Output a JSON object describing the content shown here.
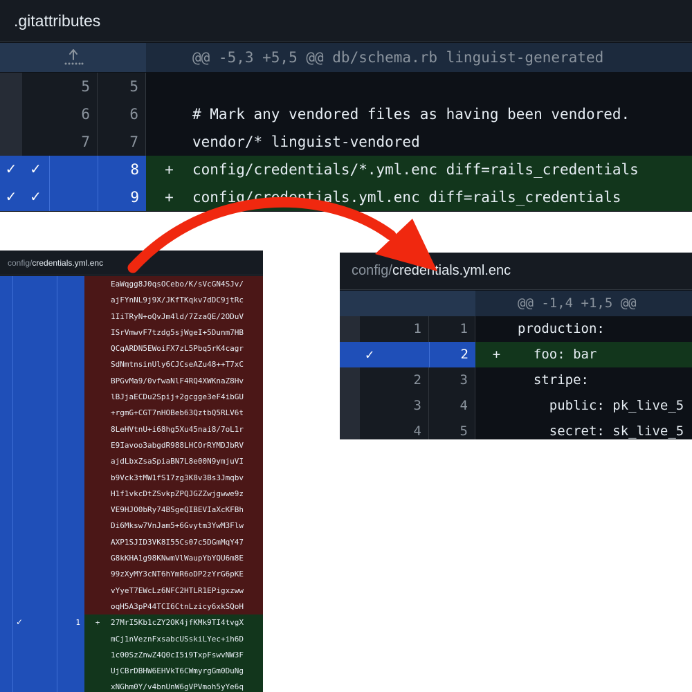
{
  "gitattributes_panel": {
    "filename": ".gitattributes",
    "expand_icon": "expand-up-icon",
    "hunk_header": "@@ -5,3 +5,5 @@ db/schema.rb linguist-generated",
    "lines": [
      {
        "old": "5",
        "new": "5",
        "sign": "",
        "code": "",
        "type": "context",
        "checked": false
      },
      {
        "old": "6",
        "new": "6",
        "sign": "",
        "code": "# Mark any vendored files as having been vendored.",
        "type": "context",
        "checked": false
      },
      {
        "old": "7",
        "new": "7",
        "sign": "",
        "code": "vendor/* linguist-vendored",
        "type": "context",
        "checked": false
      },
      {
        "old": "",
        "new": "8",
        "sign": "+",
        "code": "config/credentials/*.yml.enc diff=rails_credentials",
        "type": "added",
        "checked": true
      },
      {
        "old": "",
        "new": "9",
        "sign": "+",
        "code": "config/credentials.yml.enc diff=rails_credentials",
        "type": "added",
        "checked": true
      }
    ]
  },
  "encrypted_panel": {
    "dir": "config/",
    "filename": "credentials.yml.enc",
    "deleted_lines": [
      "EaWqgg8J0qsOCebo/K/sVcGN4SJv/",
      "ajFYnNL9j9X/JKfTKqkv7dDC9jtRc",
      "1IiTRyN+oQvJm4ld/7ZzaQE/2ODuV",
      "ISrVmwvF7tzdg5sjWgeI+5Dunm7HB",
      "QCqARDN5EWoiFX7zL5Pbq5rK4cagr",
      "SdNmtnsinUly6CJCseAZu48++T7xC",
      "BPGvMa9/0vfwaNlF4RQ4XWKnaZ8Hv",
      "lBJjaECDu2Spij+2gcgge3eF4ibGU",
      "+rgmG+CGT7nHOBeb63QztbQ5RLV6t",
      "8LeHVtnU+i68hg5Xu45nai8/7oL1r",
      "E9Iavoo3abgdR988LHCOrRYMDJbRV",
      "ajdLbxZsaSpiaBN7L8e00N9ymjuVI",
      "b9Vck3tMW1fS17zg3K8v3Bs3Jmqbv",
      "H1f1vkcDtZSvkpZPQJGZZwjgwwe9z",
      "VE9HJO0bRy74BSgeQIBEVIaXcKFBh",
      "Di6Mksw7VnJam5+6Gvytm3YwM3Flw",
      "AXP1SJID3VK8I55Cs07c5DGmMqY47",
      "G8kKHA1g98KNwmVlWaupYbYQU6m8E",
      "99zXyMY3cNT6hYmR6oDP2zYrG6pKE",
      "vYyeT7EWcLz6NFC2HTLR1EPigxzww",
      "oqH5A3pP44TCI6CtnLzicy6xkSQoH"
    ],
    "added_lines": [
      {
        "num": "1",
        "sign": "+",
        "code": "27MrI5Kb1cZY2OK4jfKMk9TI4tvgX",
        "checked": true
      },
      {
        "num": "",
        "sign": "",
        "code": "mCj1nVeznFxsabcUSskiLYec+ih6D",
        "checked": false
      },
      {
        "num": "",
        "sign": "",
        "code": "1c00SzZnwZ4Q0cI5i9TxpFswvNW3F",
        "checked": false
      },
      {
        "num": "",
        "sign": "",
        "code": "UjCBrDBHW6EHVkT6CWmyrgGm0DuNg",
        "checked": false
      },
      {
        "num": "",
        "sign": "",
        "code": "xNGhm0Y/v4bnUnW6gVPVmoh5yYe6q",
        "checked": false
      }
    ]
  },
  "decrypted_panel": {
    "dir": "config/",
    "filename": "credentials.yml.enc",
    "hunk_header": "@@ -1,4 +1,5 @@",
    "lines": [
      {
        "old": "1",
        "new": "1",
        "sign": "",
        "code": "production:",
        "type": "context",
        "checked": false
      },
      {
        "old": "",
        "new": "2",
        "sign": "+",
        "code": "  foo: bar",
        "type": "added",
        "checked": true
      },
      {
        "old": "2",
        "new": "3",
        "sign": "",
        "code": "  stripe:",
        "type": "context",
        "checked": false
      },
      {
        "old": "3",
        "new": "4",
        "sign": "",
        "code": "    public: pk_live_5",
        "type": "context",
        "checked": false
      },
      {
        "old": "4",
        "new": "5",
        "sign": "",
        "code": "    secret: sk_live_5",
        "type": "context",
        "checked": false
      }
    ]
  },
  "colors": {
    "background": "#0d1117",
    "selected_gutter": "#1f4fb8",
    "added_row": "#12361c",
    "deleted_row": "#4b1717",
    "arrow": "#f0280f"
  },
  "icons": {
    "check": "check-icon",
    "expand": "expand-up-icon",
    "arrow": "curved-arrow-icon"
  }
}
